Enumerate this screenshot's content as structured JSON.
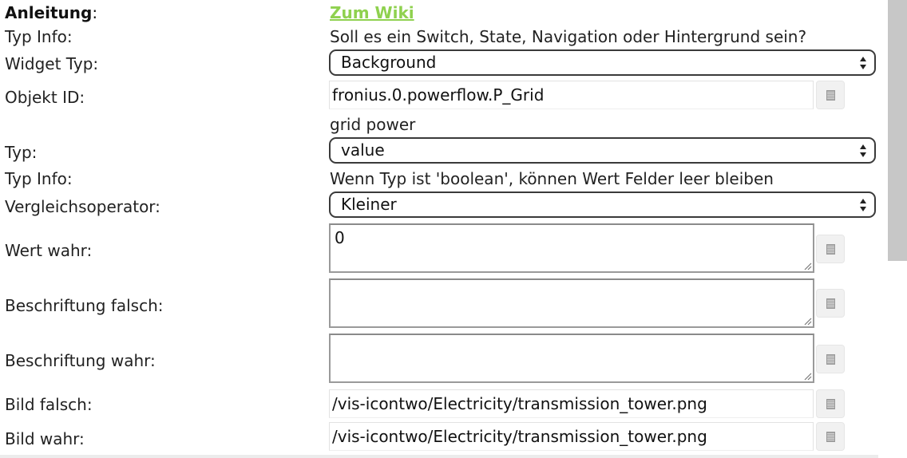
{
  "rows": {
    "anleitung": {
      "label": "Anleitung",
      "colon": ":",
      "link": "Zum Wiki"
    },
    "typ_info_1": {
      "label": "Typ Info:",
      "text": "Soll es ein Switch, State, Navigation oder Hintergrund sein?"
    },
    "widget_typ": {
      "label": "Widget Typ:",
      "selected": "Background"
    },
    "objekt_id": {
      "label": "Objekt ID:",
      "value": "fronius.0.powerflow.P_Grid",
      "hint": "grid power"
    },
    "typ": {
      "label": "Typ:",
      "selected": "value"
    },
    "typ_info_2": {
      "label": "Typ Info:",
      "text": "Wenn Typ ist 'boolean', können Wert Felder leer bleiben"
    },
    "vergleichsoperator": {
      "label": "Vergleichsoperator:",
      "selected": "Kleiner"
    },
    "wert_wahr": {
      "label": "Wert wahr:",
      "value": "0"
    },
    "beschriftung_falsch": {
      "label": "Beschriftung falsch:",
      "value": ""
    },
    "beschriftung_wahr": {
      "label": "Beschriftung wahr:",
      "value": ""
    },
    "bild_falsch": {
      "label": "Bild falsch:",
      "value": "/vis-icontwo/Electricity/transmission_tower.png"
    },
    "bild_wahr": {
      "label": "Bild wahr:",
      "value": "/vis-icontwo/Electricity/transmission_tower.png"
    }
  },
  "colors": {
    "link": "#8fd14f",
    "scrollbar_thumb": "#c7c7c7",
    "select_border": "#3a3a3a"
  },
  "icons": {
    "picker": "object-picker-icon",
    "select_arrows": "updown-arrows-icon",
    "resize": "resize-grip-icon"
  }
}
